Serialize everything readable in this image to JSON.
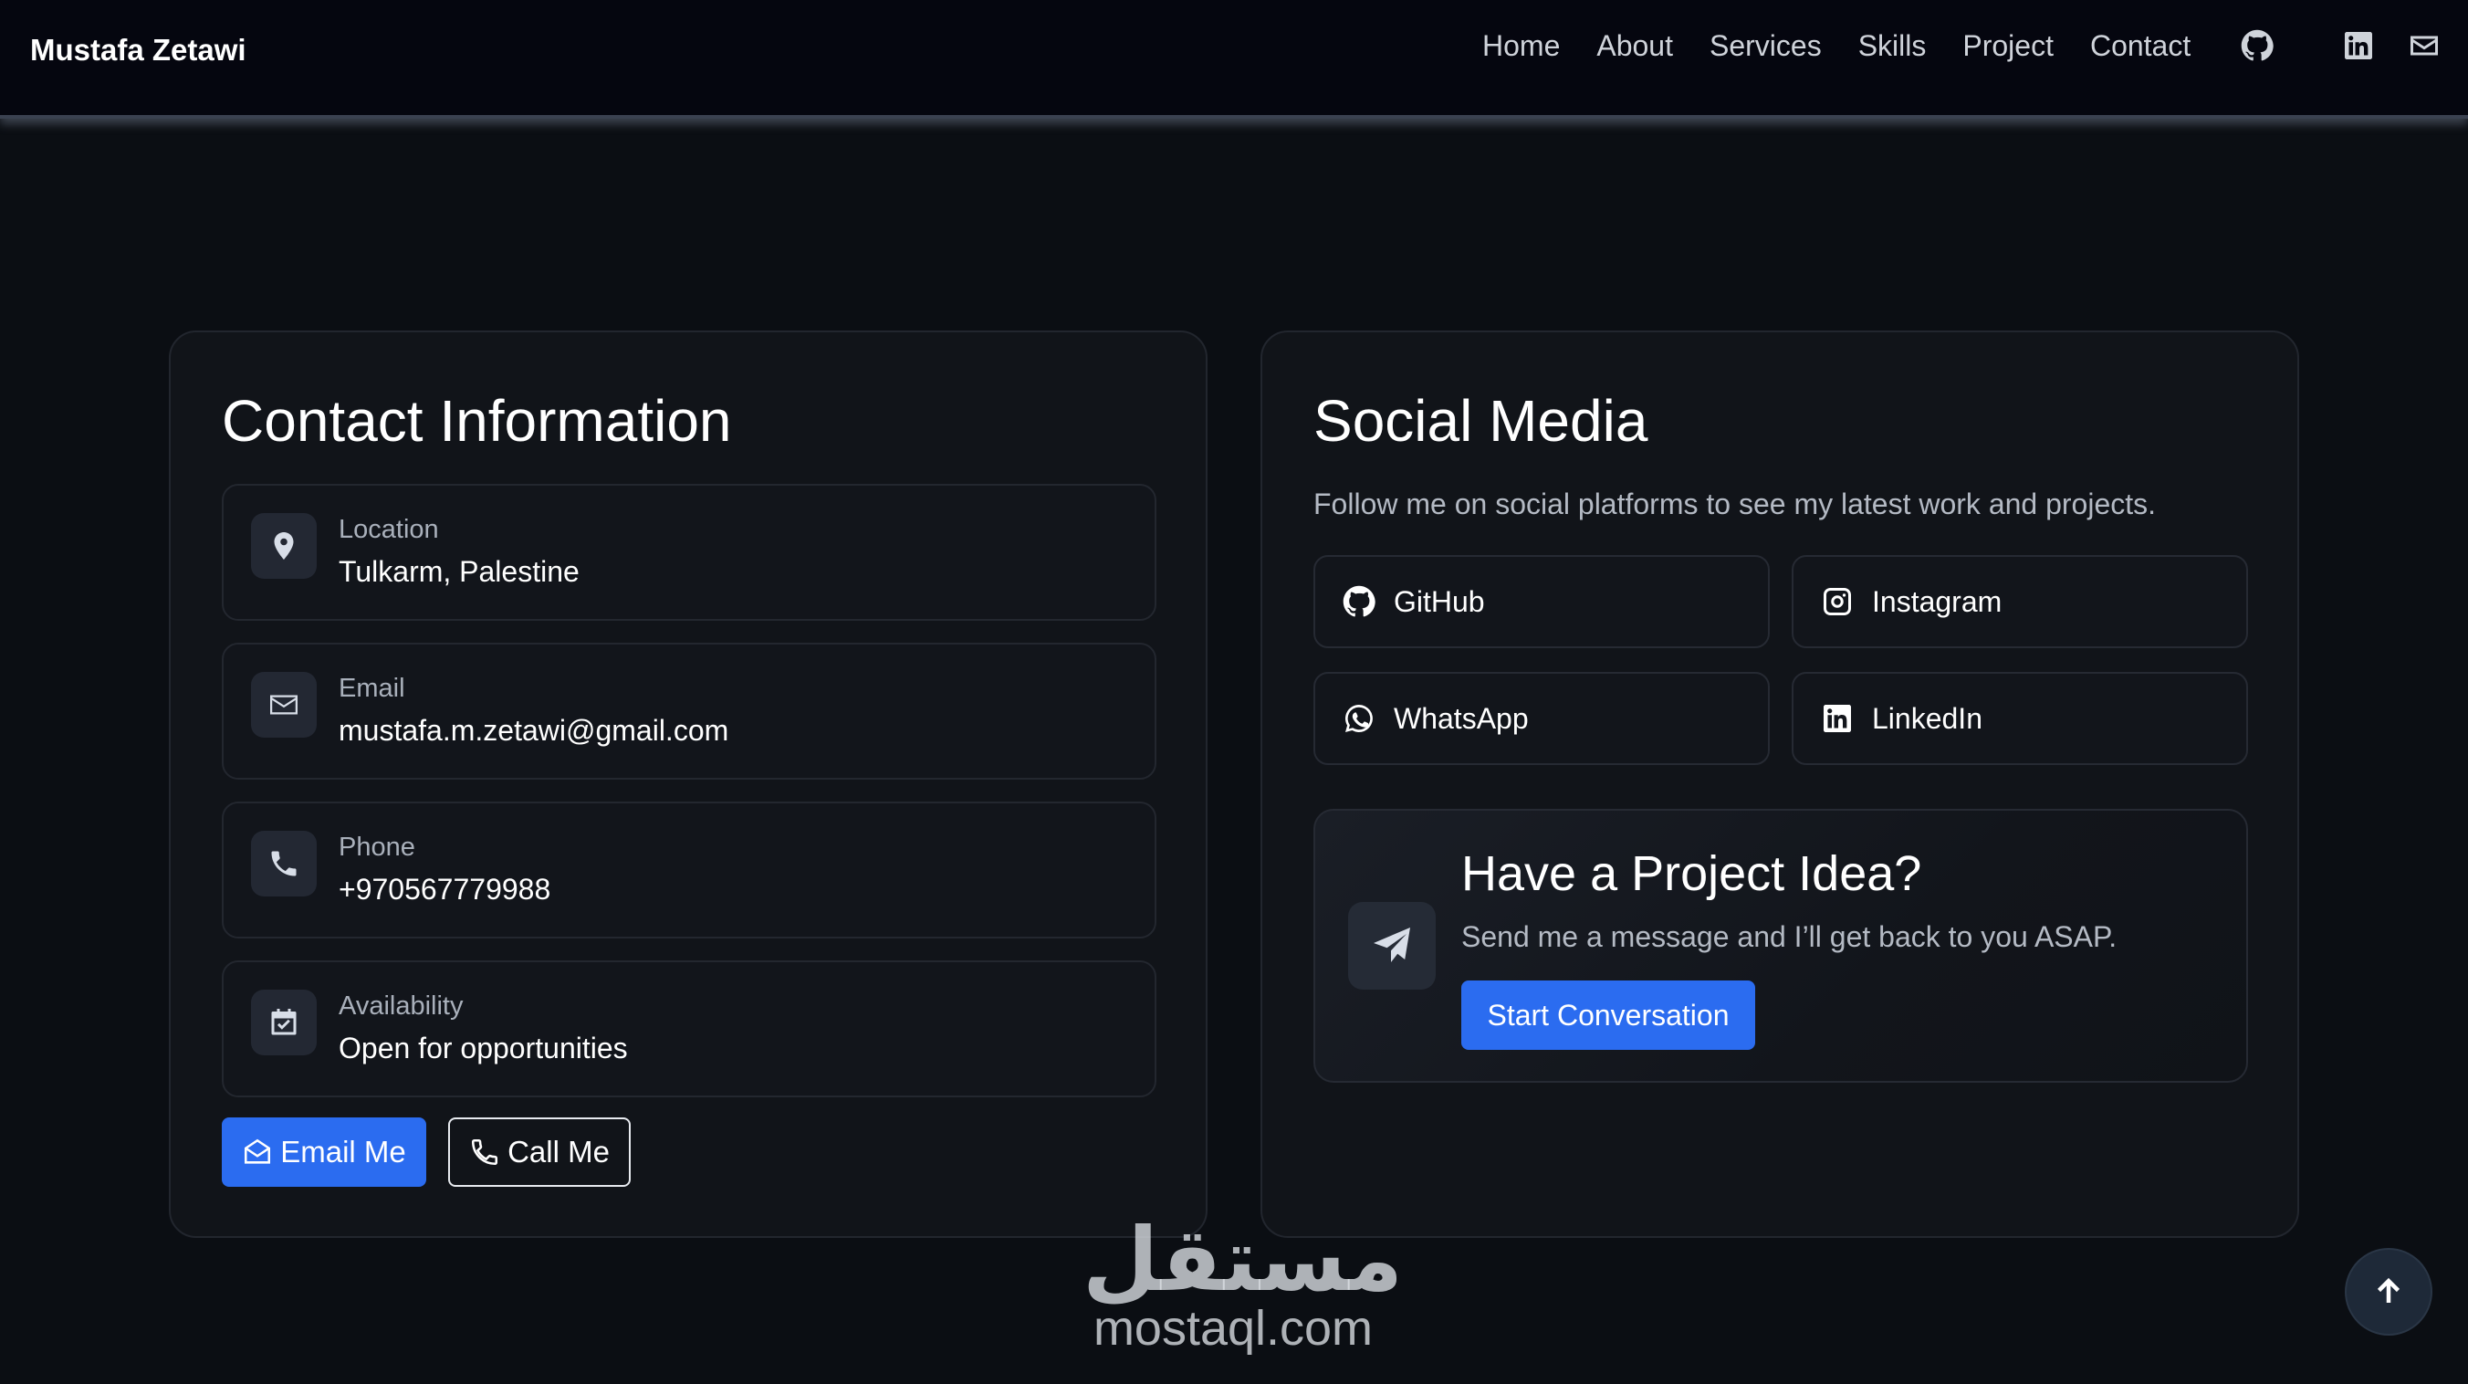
{
  "nav": {
    "brand": "Mustafa Zetawi",
    "links": [
      "Home",
      "About",
      "Services",
      "Skills",
      "Project",
      "Contact"
    ],
    "icons": [
      "github-icon",
      "linkedin-icon",
      "email-icon"
    ]
  },
  "contact": {
    "title": "Contact Information",
    "items": [
      {
        "label": "Location",
        "value": "Tulkarm, Palestine",
        "icon": "location-pin-icon"
      },
      {
        "label": "Email",
        "value": "mustafa.m.zetawi@gmail.com",
        "icon": "envelope-icon"
      },
      {
        "label": "Phone",
        "value": "+970567779988",
        "icon": "phone-icon"
      },
      {
        "label": "Availability",
        "value": "Open for opportunities",
        "icon": "calendar-check-icon"
      }
    ],
    "email_button": "Email Me",
    "call_button": "Call Me"
  },
  "social": {
    "title": "Social Media",
    "description": "Follow me on social platforms to see my latest work and projects.",
    "buttons": [
      {
        "label": "GitHub",
        "icon": "github-icon"
      },
      {
        "label": "Instagram",
        "icon": "instagram-icon"
      },
      {
        "label": "WhatsApp",
        "icon": "whatsapp-icon"
      },
      {
        "label": "LinkedIn",
        "icon": "linkedin-icon"
      }
    ]
  },
  "project": {
    "title": "Have a Project Idea?",
    "subtitle": "Send me a message and I’ll get back to you ASAP.",
    "button": "Start Conversation",
    "icon": "paper-plane-icon"
  },
  "watermark": {
    "arabic": "مستقل",
    "latin": "mostaql.com"
  },
  "colors": {
    "accent": "#2b6cf0",
    "background": "#0b0e13",
    "card": "#111419",
    "navbar": "#05060f"
  }
}
